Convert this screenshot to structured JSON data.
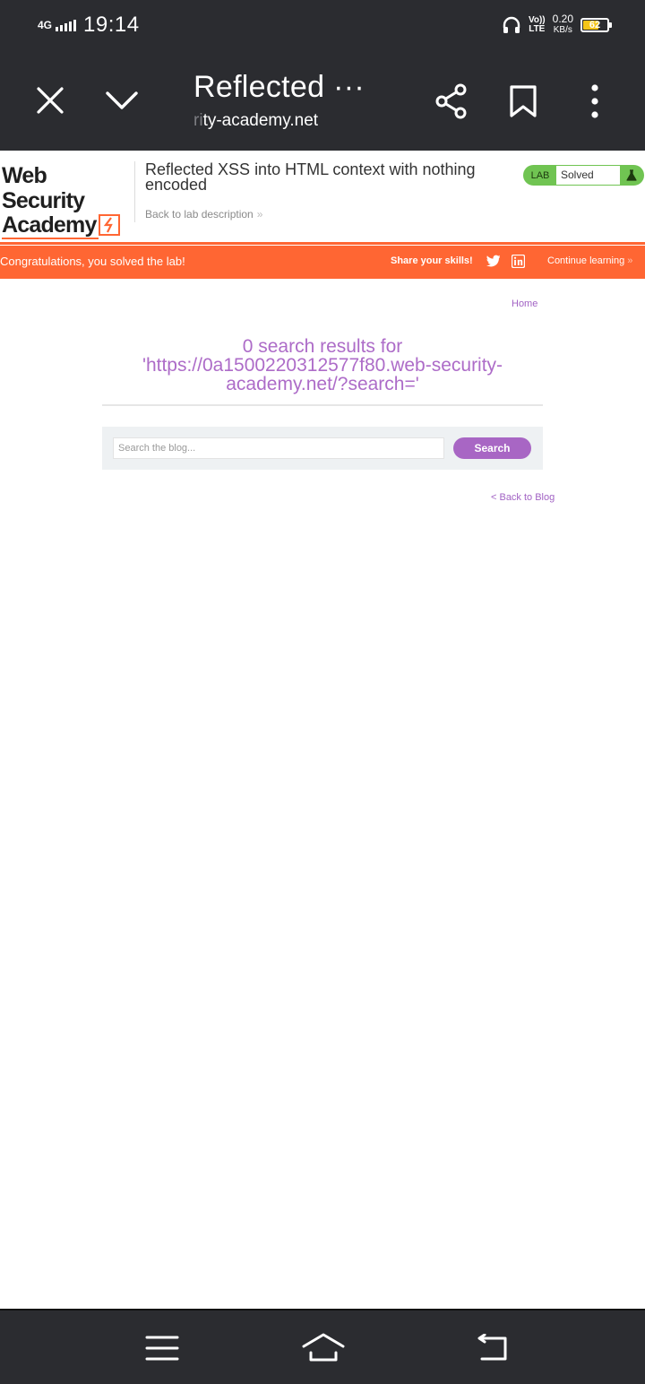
{
  "status_bar": {
    "network": "4G",
    "time": "19:14",
    "volte_line1": "Vo))",
    "volte_line2": "LTE",
    "speed_value": "0.20",
    "speed_unit": "KB/s",
    "battery_level": "62",
    "icons": [
      "signal-icon",
      "headphones-icon",
      "battery-icon"
    ]
  },
  "browser": {
    "page_title": "Reflected ···",
    "url_faded": "ri",
    "url_visible": "ty-academy.net",
    "icons": [
      "close-icon",
      "chevron-down-icon",
      "share-icon",
      "bookmark-icon",
      "more-icon"
    ]
  },
  "academy_header": {
    "logo_line1": "Web Security",
    "logo_line2": "Academy",
    "lab_title": "Reflected XSS into HTML context with nothing encoded",
    "back_to_description": "Back to lab description",
    "back_chevron": "»",
    "lab_badge": "LAB",
    "lab_status": "Solved"
  },
  "congrats_bar": {
    "message": "Congratulations, you solved the lab!",
    "share": "Share your skills!",
    "continue": "Continue learning",
    "continue_chevron": "»",
    "accent": "#ff6633"
  },
  "page": {
    "home_link": "Home",
    "results_heading": "0 search results for 'https://0a1500220312577f80.web-security-academy.net/?search='",
    "search_placeholder": "Search the blog...",
    "search_button": "Search",
    "back_to_blog": "< Back to Blog",
    "link_color": "#a263c4"
  },
  "nav_bar": {
    "icons": [
      "menu-icon",
      "home-icon",
      "back-icon"
    ]
  }
}
